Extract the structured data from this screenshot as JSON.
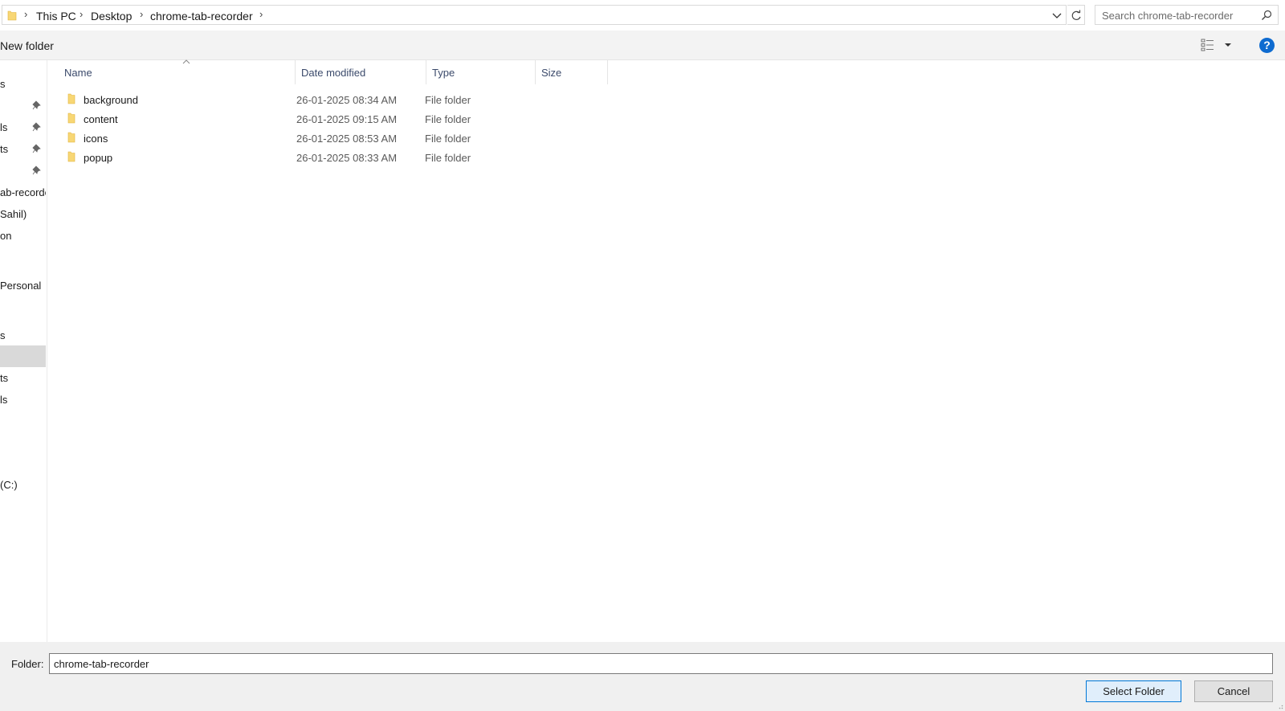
{
  "address_bar": {
    "breadcrumbs": [
      "This PC",
      "Desktop",
      "chrome-tab-recorder"
    ]
  },
  "search": {
    "placeholder": "Search chrome-tab-recorder"
  },
  "toolbar": {
    "new_folder_label": "New folder",
    "help_label": "?"
  },
  "nav_pane": {
    "items": [
      {
        "label": "s",
        "pinned": false
      },
      {
        "label": "",
        "pinned": true
      },
      {
        "label": "ls",
        "pinned": true
      },
      {
        "label": "ts",
        "pinned": true
      },
      {
        "label": "",
        "pinned": true
      },
      {
        "label": "ab-recorder",
        "pinned": false
      },
      {
        "label": "Sahil)",
        "pinned": false
      },
      {
        "label": "on",
        "pinned": false
      },
      {
        "label": "Personal",
        "pinned": false
      },
      {
        "label": "s",
        "pinned": false
      },
      {
        "label": "",
        "pinned": false,
        "selected": true
      },
      {
        "label": "ts",
        "pinned": false
      },
      {
        "label": "ls",
        "pinned": false
      },
      {
        "label": "(C:)",
        "pinned": false
      }
    ]
  },
  "file_list": {
    "columns": [
      "Name",
      "Date modified",
      "Type",
      "Size"
    ],
    "rows": [
      {
        "name": "background",
        "date": "26-01-2025 08:34 AM",
        "type": "File folder",
        "size": ""
      },
      {
        "name": "content",
        "date": "26-01-2025 09:15 AM",
        "type": "File folder",
        "size": ""
      },
      {
        "name": "icons",
        "date": "26-01-2025 08:53 AM",
        "type": "File folder",
        "size": ""
      },
      {
        "name": "popup",
        "date": "26-01-2025 08:33 AM",
        "type": "File folder",
        "size": ""
      }
    ]
  },
  "bottom": {
    "folder_label": "Folder:",
    "folder_value": "chrome-tab-recorder",
    "select_button": "Select Folder",
    "cancel_button": "Cancel"
  },
  "colors": {
    "accent": "#0078d7",
    "help_blue": "#0e6bd0",
    "folder_yellow": "#f8d775",
    "selection_gray": "#d9d9d9"
  },
  "icons": [
    "folder-icon",
    "chevron-right-icon",
    "chevron-down-icon",
    "refresh-icon",
    "search-icon",
    "view-options-icon",
    "help-icon",
    "pin-icon",
    "sort-up-icon"
  ]
}
